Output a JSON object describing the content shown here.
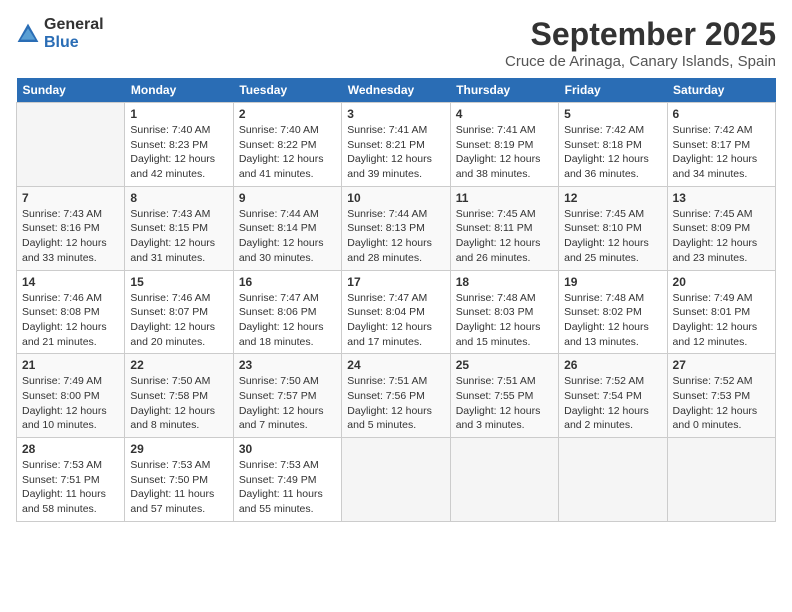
{
  "logo": {
    "general": "General",
    "blue": "Blue"
  },
  "header": {
    "month": "September 2025",
    "location": "Cruce de Arinaga, Canary Islands, Spain"
  },
  "days_of_week": [
    "Sunday",
    "Monday",
    "Tuesday",
    "Wednesday",
    "Thursday",
    "Friday",
    "Saturday"
  ],
  "weeks": [
    [
      {
        "day": "",
        "sunrise": "",
        "sunset": "",
        "daylight": ""
      },
      {
        "day": "1",
        "sunrise": "Sunrise: 7:40 AM",
        "sunset": "Sunset: 8:23 PM",
        "daylight": "Daylight: 12 hours and 42 minutes."
      },
      {
        "day": "2",
        "sunrise": "Sunrise: 7:40 AM",
        "sunset": "Sunset: 8:22 PM",
        "daylight": "Daylight: 12 hours and 41 minutes."
      },
      {
        "day": "3",
        "sunrise": "Sunrise: 7:41 AM",
        "sunset": "Sunset: 8:21 PM",
        "daylight": "Daylight: 12 hours and 39 minutes."
      },
      {
        "day": "4",
        "sunrise": "Sunrise: 7:41 AM",
        "sunset": "Sunset: 8:19 PM",
        "daylight": "Daylight: 12 hours and 38 minutes."
      },
      {
        "day": "5",
        "sunrise": "Sunrise: 7:42 AM",
        "sunset": "Sunset: 8:18 PM",
        "daylight": "Daylight: 12 hours and 36 minutes."
      },
      {
        "day": "6",
        "sunrise": "Sunrise: 7:42 AM",
        "sunset": "Sunset: 8:17 PM",
        "daylight": "Daylight: 12 hours and 34 minutes."
      }
    ],
    [
      {
        "day": "7",
        "sunrise": "Sunrise: 7:43 AM",
        "sunset": "Sunset: 8:16 PM",
        "daylight": "Daylight: 12 hours and 33 minutes."
      },
      {
        "day": "8",
        "sunrise": "Sunrise: 7:43 AM",
        "sunset": "Sunset: 8:15 PM",
        "daylight": "Daylight: 12 hours and 31 minutes."
      },
      {
        "day": "9",
        "sunrise": "Sunrise: 7:44 AM",
        "sunset": "Sunset: 8:14 PM",
        "daylight": "Daylight: 12 hours and 30 minutes."
      },
      {
        "day": "10",
        "sunrise": "Sunrise: 7:44 AM",
        "sunset": "Sunset: 8:13 PM",
        "daylight": "Daylight: 12 hours and 28 minutes."
      },
      {
        "day": "11",
        "sunrise": "Sunrise: 7:45 AM",
        "sunset": "Sunset: 8:11 PM",
        "daylight": "Daylight: 12 hours and 26 minutes."
      },
      {
        "day": "12",
        "sunrise": "Sunrise: 7:45 AM",
        "sunset": "Sunset: 8:10 PM",
        "daylight": "Daylight: 12 hours and 25 minutes."
      },
      {
        "day": "13",
        "sunrise": "Sunrise: 7:45 AM",
        "sunset": "Sunset: 8:09 PM",
        "daylight": "Daylight: 12 hours and 23 minutes."
      }
    ],
    [
      {
        "day": "14",
        "sunrise": "Sunrise: 7:46 AM",
        "sunset": "Sunset: 8:08 PM",
        "daylight": "Daylight: 12 hours and 21 minutes."
      },
      {
        "day": "15",
        "sunrise": "Sunrise: 7:46 AM",
        "sunset": "Sunset: 8:07 PM",
        "daylight": "Daylight: 12 hours and 20 minutes."
      },
      {
        "day": "16",
        "sunrise": "Sunrise: 7:47 AM",
        "sunset": "Sunset: 8:06 PM",
        "daylight": "Daylight: 12 hours and 18 minutes."
      },
      {
        "day": "17",
        "sunrise": "Sunrise: 7:47 AM",
        "sunset": "Sunset: 8:04 PM",
        "daylight": "Daylight: 12 hours and 17 minutes."
      },
      {
        "day": "18",
        "sunrise": "Sunrise: 7:48 AM",
        "sunset": "Sunset: 8:03 PM",
        "daylight": "Daylight: 12 hours and 15 minutes."
      },
      {
        "day": "19",
        "sunrise": "Sunrise: 7:48 AM",
        "sunset": "Sunset: 8:02 PM",
        "daylight": "Daylight: 12 hours and 13 minutes."
      },
      {
        "day": "20",
        "sunrise": "Sunrise: 7:49 AM",
        "sunset": "Sunset: 8:01 PM",
        "daylight": "Daylight: 12 hours and 12 minutes."
      }
    ],
    [
      {
        "day": "21",
        "sunrise": "Sunrise: 7:49 AM",
        "sunset": "Sunset: 8:00 PM",
        "daylight": "Daylight: 12 hours and 10 minutes."
      },
      {
        "day": "22",
        "sunrise": "Sunrise: 7:50 AM",
        "sunset": "Sunset: 7:58 PM",
        "daylight": "Daylight: 12 hours and 8 minutes."
      },
      {
        "day": "23",
        "sunrise": "Sunrise: 7:50 AM",
        "sunset": "Sunset: 7:57 PM",
        "daylight": "Daylight: 12 hours and 7 minutes."
      },
      {
        "day": "24",
        "sunrise": "Sunrise: 7:51 AM",
        "sunset": "Sunset: 7:56 PM",
        "daylight": "Daylight: 12 hours and 5 minutes."
      },
      {
        "day": "25",
        "sunrise": "Sunrise: 7:51 AM",
        "sunset": "Sunset: 7:55 PM",
        "daylight": "Daylight: 12 hours and 3 minutes."
      },
      {
        "day": "26",
        "sunrise": "Sunrise: 7:52 AM",
        "sunset": "Sunset: 7:54 PM",
        "daylight": "Daylight: 12 hours and 2 minutes."
      },
      {
        "day": "27",
        "sunrise": "Sunrise: 7:52 AM",
        "sunset": "Sunset: 7:53 PM",
        "daylight": "Daylight: 12 hours and 0 minutes."
      }
    ],
    [
      {
        "day": "28",
        "sunrise": "Sunrise: 7:53 AM",
        "sunset": "Sunset: 7:51 PM",
        "daylight": "Daylight: 11 hours and 58 minutes."
      },
      {
        "day": "29",
        "sunrise": "Sunrise: 7:53 AM",
        "sunset": "Sunset: 7:50 PM",
        "daylight": "Daylight: 11 hours and 57 minutes."
      },
      {
        "day": "30",
        "sunrise": "Sunrise: 7:53 AM",
        "sunset": "Sunset: 7:49 PM",
        "daylight": "Daylight: 11 hours and 55 minutes."
      },
      {
        "day": "",
        "sunrise": "",
        "sunset": "",
        "daylight": ""
      },
      {
        "day": "",
        "sunrise": "",
        "sunset": "",
        "daylight": ""
      },
      {
        "day": "",
        "sunrise": "",
        "sunset": "",
        "daylight": ""
      },
      {
        "day": "",
        "sunrise": "",
        "sunset": "",
        "daylight": ""
      }
    ]
  ]
}
